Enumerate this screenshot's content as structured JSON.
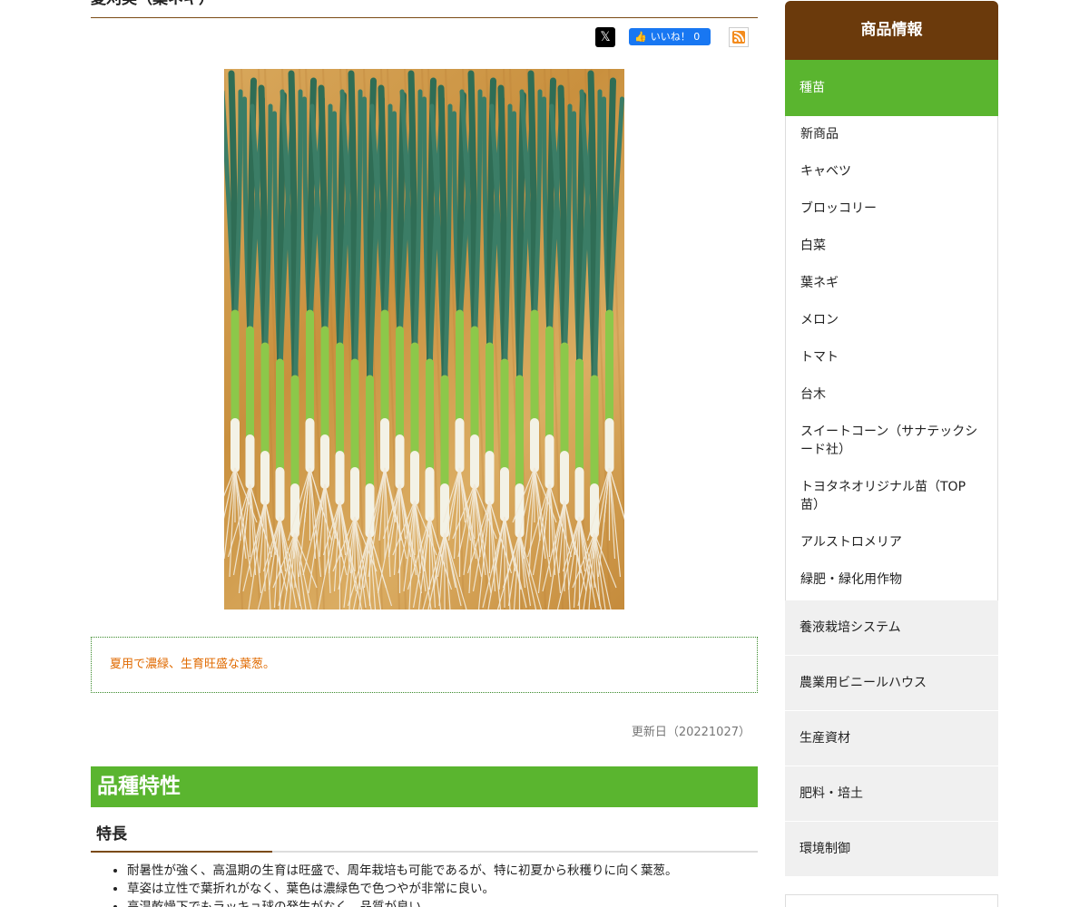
{
  "page": {
    "title": "夏刈美（葉ネギ）",
    "share": {
      "x_icon": "x-logo-icon",
      "facebook_label": "いいね！ 0",
      "rss_icon": "rss-icon"
    },
    "photo_alt": "",
    "catch_copy": "夏用で濃緑、生育旺盛な葉葱。",
    "updated": "更新日（20221027）",
    "section_heading": "品種特性",
    "sub_heading": "特長",
    "features": [
      "耐暑性が強く、高温期の生育は旺盛で、周年栽培も可能であるが、特に初夏から秋穫りに向く葉葱。",
      "草姿は立性で葉折れがなく、葉色は濃緑色で色つやが非常に良い。",
      "高温乾燥下でもラッキョ球の発生がなく、品質が良い。"
    ]
  },
  "sidebar": {
    "heading": "商品情報",
    "active_category": "種苗",
    "sub_items": [
      "新商品",
      "キャベツ",
      "ブロッコリー",
      "白菜",
      "葉ネギ",
      "メロン",
      "トマト",
      "台木",
      "スイートコーン（サナテックシード社）",
      "トヨタネオリジナル苗（TOP苗）",
      "アルストロメリア",
      "緑肥・緑化用作物"
    ],
    "categories": [
      "養液栽培システム",
      "農業用ビニールハウス",
      "生産資材",
      "肥料・培土",
      "環境制御"
    ]
  },
  "colors": {
    "brand_brown": "#6b3a0c",
    "accent_green": "#5ab52f",
    "catch_orange": "#e06a00"
  }
}
